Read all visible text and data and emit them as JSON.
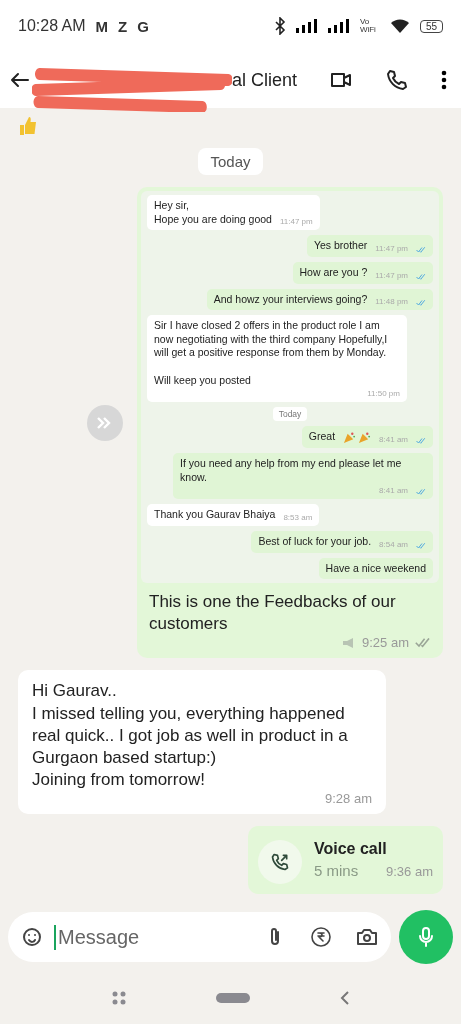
{
  "status_bar": {
    "time": "10:28 AM",
    "notifications": [
      "M",
      "Z",
      "G"
    ],
    "network": "Vo WiFi",
    "battery": "55"
  },
  "header": {
    "name": "al Client",
    "redacted": true
  },
  "date_chip": "Today",
  "image_message": {
    "screenshot": [
      {
        "kind": "message",
        "outgoing": false,
        "text": "Hey sir,\nHope you are doing good",
        "time": "11:47 pm",
        "read": false
      },
      {
        "kind": "message",
        "outgoing": true,
        "text": "Yes brother",
        "time": "11:47 pm",
        "read": true
      },
      {
        "kind": "message",
        "outgoing": true,
        "text": "How are you ?",
        "time": "11:47 pm",
        "read": true
      },
      {
        "kind": "message",
        "outgoing": true,
        "text": "And howz your interviews going?",
        "time": "11:48 pm",
        "read": true
      },
      {
        "kind": "message",
        "outgoing": false,
        "text": "Sir I have closed 2 offers in the product role I am now negotiating with the third company Hopefully,I will get a positive response from them by Monday.\n\nWill keep you posted",
        "time": "11:50 pm",
        "read": false
      },
      {
        "kind": "date",
        "text": "Today"
      },
      {
        "kind": "message",
        "outgoing": true,
        "text": "Great",
        "time": "8:41 am",
        "read": true,
        "party": true
      },
      {
        "kind": "message",
        "outgoing": true,
        "text": "If you need any help from my end please let me know.",
        "time": "8:41 am",
        "read": true
      },
      {
        "kind": "message",
        "outgoing": false,
        "text": "Thank you Gaurav Bhaiya",
        "time": "8:53 am",
        "read": false
      },
      {
        "kind": "message",
        "outgoing": true,
        "text": "Best of luck for your job.",
        "time": "8:54 am",
        "read": true
      },
      {
        "kind": "message",
        "outgoing": true,
        "text": "Have a nice weekend",
        "read": false
      }
    ],
    "caption": "This is one the Feedbacks of our customers",
    "time": "9:25 am",
    "read": false
  },
  "incoming": {
    "text": "Hi Gaurav..\nI missed telling you, everything happened real quick.. I got job as well in product in a Gurgaon based startup:)\nJoining from tomorrow!",
    "time": "9:28 am"
  },
  "call": {
    "title": "Voice call",
    "duration": "5 mins",
    "time": "9:36 am"
  },
  "composer": {
    "placeholder": "Message"
  }
}
